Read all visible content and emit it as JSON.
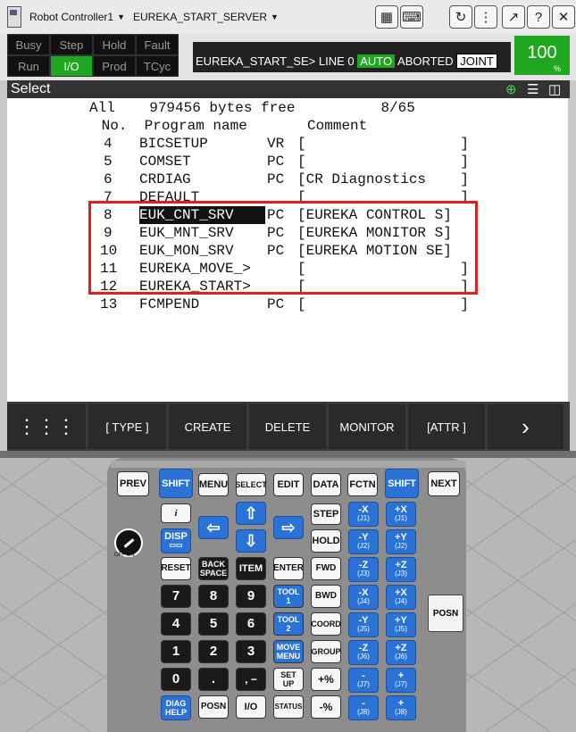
{
  "titlebar": {
    "controller": "Robot Controller1",
    "program": "EUREKA_START_SERVER"
  },
  "status": {
    "indicators": [
      "Busy",
      "Step",
      "Hold",
      "Fault",
      "Run",
      "I/O",
      "Prod",
      "TCyc"
    ],
    "line_prefix": "EUREKA_START_SE> LINE 0",
    "mode": "AUTO",
    "state": "ABORTED",
    "frame": "JOINT",
    "override": "100",
    "override_unit": "%"
  },
  "screen": {
    "title": "Select",
    "summary": "All    979456 bytes free          8/65",
    "columns": " No.  Program name       Comment",
    "rows": [
      {
        "no": "4",
        "name": "BICSETUP",
        "type": "VR",
        "comment": "[                  ]"
      },
      {
        "no": "5",
        "name": "COMSET",
        "type": "PC",
        "comment": "[                  ]"
      },
      {
        "no": "6",
        "name": "CRDIAG",
        "type": "PC",
        "comment": "[CR Diagnostics    ]"
      },
      {
        "no": "7",
        "name": "DEFAULT",
        "type": "",
        "comment": "[                  ]"
      },
      {
        "no": "8",
        "name": "EUK_CNT_SRV",
        "type": "PC",
        "comment": "[EUREKA CONTROL S]"
      },
      {
        "no": "9",
        "name": "EUK_MNT_SRV",
        "type": "PC",
        "comment": "[EUREKA MONITOR S]"
      },
      {
        "no": "10",
        "name": "EUK_MON_SRV",
        "type": "PC",
        "comment": "[EUREKA MOTION SE]"
      },
      {
        "no": "11",
        "name": "EUREKA_MOVE_>",
        "type": "",
        "comment": "[                  ]"
      },
      {
        "no": "12",
        "name": "EUREKA_START>",
        "type": "",
        "comment": "[                  ]"
      },
      {
        "no": "13",
        "name": "FCMPEND",
        "type": "PC",
        "comment": "[                  ]"
      }
    ]
  },
  "fkeys": [
    "[ TYPE ]",
    "CREATE",
    "DELETE",
    "MONITOR",
    "[ATTR ]"
  ],
  "pendant": {
    "row1": [
      "PREV",
      "SHIFT",
      "MENU",
      "SELECT",
      "EDIT",
      "DATA",
      "FCTN",
      "SHIFT",
      "NEXT"
    ],
    "disp": "DISP",
    "step": "STEP",
    "hold": "HOLD",
    "fwd": "FWD",
    "bwd": "BWD",
    "coord": "COORD",
    "group": "GROUP",
    "reset": "RESET",
    "backspace_1": "BACK",
    "backspace_2": "SPACE",
    "item": "ITEM",
    "enter": "ENTER",
    "tool1_1": "TOOL",
    "tool1_2": "1",
    "tool2_1": "TOOL",
    "tool2_2": "2",
    "movemenu_1": "MOVE",
    "movemenu_2": "MENU",
    "setup_1": "SET",
    "setup_2": "UP",
    "diag_1": "DIAG",
    "diag_2": "HELP",
    "posn": "POSN",
    "io": "I/O",
    "status": "STATUS",
    "posn_side": "POSN",
    "numbers": [
      "7",
      "8",
      "9",
      "4",
      "5",
      "6",
      "1",
      "2",
      "3",
      "0",
      "."
    ],
    "plus_pct": "+%",
    "minus_pct": "-%",
    "jog_minus": [
      [
        "-X",
        "(J1)"
      ],
      [
        "-Y",
        "(J2)"
      ],
      [
        "-Z",
        "(J3)"
      ],
      [
        "-X",
        "(J4)"
      ],
      [
        "-Y",
        "(J5)"
      ],
      [
        "-Z",
        "(J6)"
      ],
      [
        "-",
        "(J7)"
      ],
      [
        "-",
        "(J8)"
      ]
    ],
    "jog_plus": [
      [
        "+X",
        "(J1)"
      ],
      [
        "+Y",
        "(J2)"
      ],
      [
        "+Z",
        "(J3)"
      ],
      [
        "+X",
        "(J4)"
      ],
      [
        "+Y",
        "(J5)"
      ],
      [
        "+Z",
        "(J6)"
      ],
      [
        "+",
        "(J7)"
      ],
      [
        "+",
        "(J8)"
      ]
    ],
    "dial_label": "OFF  ON"
  }
}
